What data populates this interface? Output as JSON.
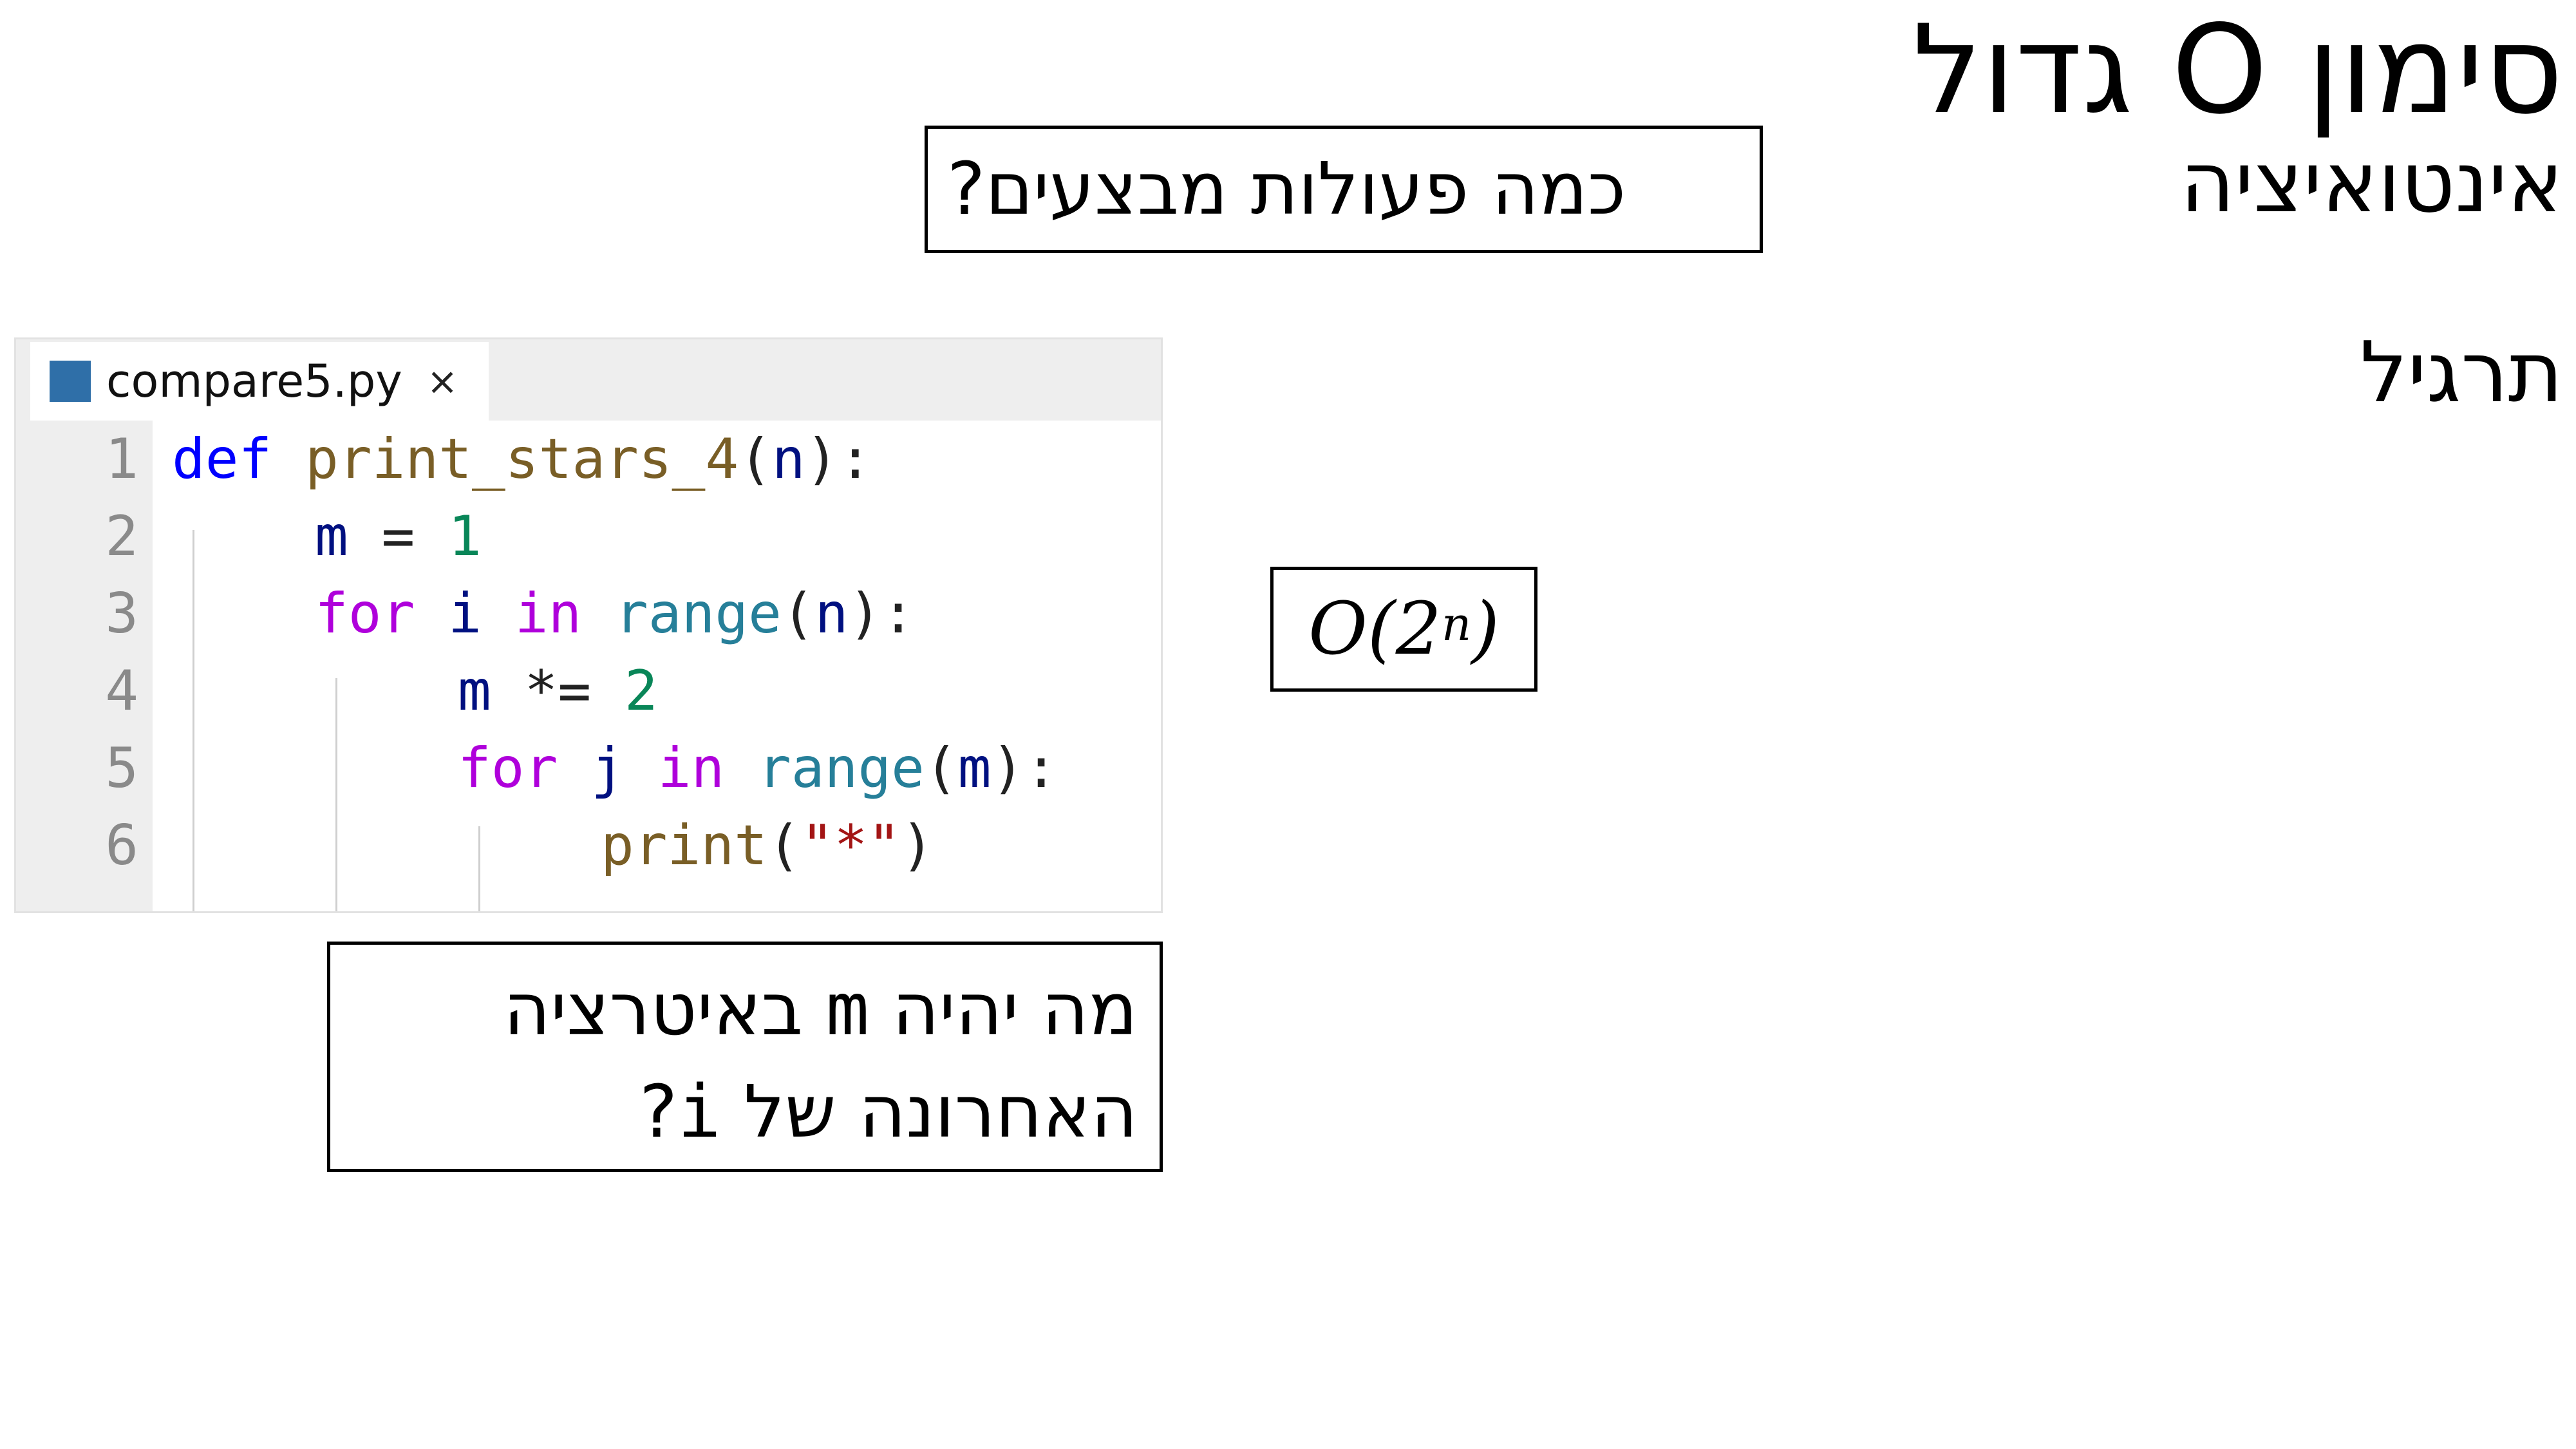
{
  "slide": {
    "title": "סימון O גדול",
    "subtitle": "אינטואיציה",
    "section": "תרגיל",
    "ops_question": "כמה פעולות מבצעים?",
    "complexity": {
      "base": "O(2",
      "exponent": "n",
      "close": ")"
    },
    "last_iteration_question": {
      "line1_part1": "מה יהיה ",
      "line1_code": "m",
      "line1_part2": " באיטרציה",
      "line2_part1": "האחרונה של ",
      "line2_code": "i",
      "line2_part2": "?"
    }
  },
  "editor": {
    "tab": {
      "filename": "compare5.py",
      "close": "×"
    },
    "line_numbers": [
      "1",
      "2",
      "3",
      "4",
      "5",
      "6"
    ],
    "code": {
      "l1": {
        "def": "def",
        "name": "print_stars_4",
        "open": "(",
        "param": "n",
        "close": "):"
      },
      "l2": {
        "var": "m",
        "op": " = ",
        "num": "1"
      },
      "l3": {
        "for": "for",
        "var": "i",
        "in": "in",
        "fn": "range",
        "open": "(",
        "arg": "n",
        "close": "):"
      },
      "l4": {
        "var": "m",
        "op": " *= ",
        "num": "2"
      },
      "l5": {
        "for": "for",
        "var": "j",
        "in": "in",
        "fn": "range",
        "open": "(",
        "arg": "m",
        "close": "):"
      },
      "l6": {
        "fn": "print",
        "open": "(",
        "str": "\"*\"",
        "close": ")"
      }
    }
  },
  "colors": {
    "keyword": "#0000ff",
    "function": "#795e26",
    "variable": "#001080",
    "number": "#098658",
    "control": "#af00db",
    "builtin": "#267f99",
    "string": "#a31515",
    "file_icon": "#2f6fa8"
  }
}
